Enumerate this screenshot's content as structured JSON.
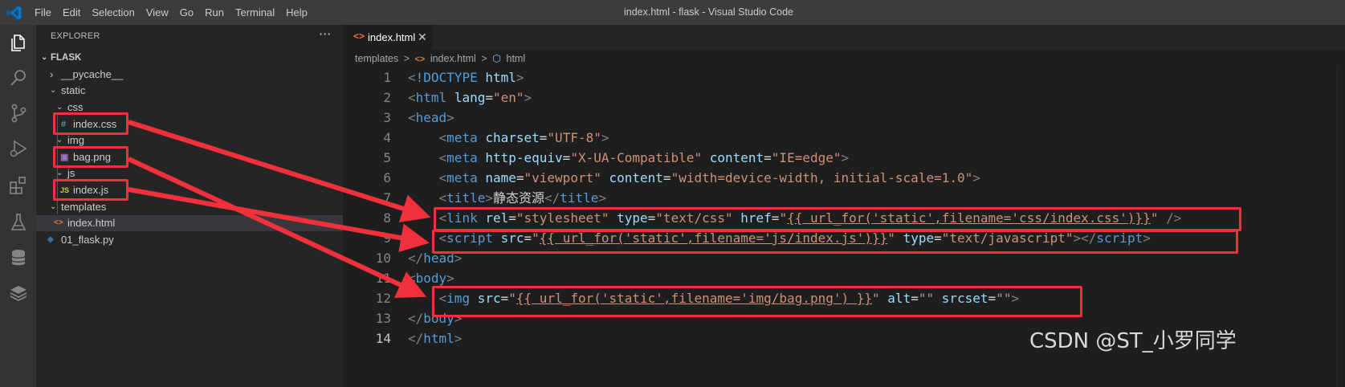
{
  "window": {
    "title": "index.html - flask - Visual Studio Code",
    "menu": [
      "File",
      "Edit",
      "Selection",
      "View",
      "Go",
      "Run",
      "Terminal",
      "Help"
    ]
  },
  "activity_bar": [
    "explorer-icon",
    "search-icon",
    "source-control-icon",
    "run-debug-icon",
    "extensions-icon",
    "testing-icon",
    "database-icon",
    "layers-icon"
  ],
  "explorer": {
    "header": "EXPLORER",
    "more": "···",
    "tree": [
      {
        "label": "FLASK",
        "kind": "root",
        "twisty": "⌄"
      },
      {
        "label": "__pycache__",
        "kind": "folder",
        "twisty": "›"
      },
      {
        "label": "static",
        "kind": "folder",
        "twisty": "⌄"
      },
      {
        "label": "css",
        "kind": "folder",
        "twisty": "⌄"
      },
      {
        "label": "index.css",
        "kind": "file",
        "icon": "#"
      },
      {
        "label": "img",
        "kind": "folder",
        "twisty": "⌄"
      },
      {
        "label": "bag.png",
        "kind": "file",
        "icon": "▣"
      },
      {
        "label": "js",
        "kind": "folder",
        "twisty": "⌄"
      },
      {
        "label": "index.js",
        "kind": "file",
        "icon": "JS"
      },
      {
        "label": "templates",
        "kind": "folder",
        "twisty": "⌄"
      },
      {
        "label": "index.html",
        "kind": "file",
        "icon": "<>"
      },
      {
        "label": "01_flask.py",
        "kind": "file",
        "icon": "◆"
      }
    ]
  },
  "tab": {
    "icon": "<>",
    "label": "index.html",
    "close": "✕"
  },
  "breadcrumb": {
    "folder": "templates",
    "sep": ">",
    "file_icon": "<>",
    "file": "index.html",
    "symbol_icon": "⬡",
    "symbol": "html"
  },
  "editor": {
    "line_numbers": [
      "1",
      "2",
      "3",
      "4",
      "5",
      "6",
      "7",
      "8",
      "9",
      "10",
      "11",
      "12",
      "13",
      "14"
    ],
    "current_line": 14,
    "lines": [
      [
        [
          "p",
          "<"
        ],
        [
          "t",
          "!DOCTYPE"
        ],
        [
          "x",
          " "
        ],
        [
          "a",
          "html"
        ],
        [
          "p",
          ">"
        ]
      ],
      [
        [
          "p",
          "<"
        ],
        [
          "t",
          "html"
        ],
        [
          "x",
          " "
        ],
        [
          "a",
          "lang"
        ],
        [
          "x",
          "="
        ],
        [
          "s",
          "\"en\""
        ],
        [
          "p",
          ">"
        ]
      ],
      [
        [
          "p",
          "<"
        ],
        [
          "t",
          "head"
        ],
        [
          "p",
          ">"
        ]
      ],
      [
        [
          "x",
          "    "
        ],
        [
          "p",
          "<"
        ],
        [
          "t",
          "meta"
        ],
        [
          "x",
          " "
        ],
        [
          "a",
          "charset"
        ],
        [
          "x",
          "="
        ],
        [
          "s",
          "\"UTF-8\""
        ],
        [
          "p",
          ">"
        ]
      ],
      [
        [
          "x",
          "    "
        ],
        [
          "p",
          "<"
        ],
        [
          "t",
          "meta"
        ],
        [
          "x",
          " "
        ],
        [
          "a",
          "http-equiv"
        ],
        [
          "x",
          "="
        ],
        [
          "s",
          "\"X-UA-Compatible\""
        ],
        [
          "x",
          " "
        ],
        [
          "a",
          "content"
        ],
        [
          "x",
          "="
        ],
        [
          "s",
          "\"IE=edge\""
        ],
        [
          "p",
          ">"
        ]
      ],
      [
        [
          "x",
          "    "
        ],
        [
          "p",
          "<"
        ],
        [
          "t",
          "meta"
        ],
        [
          "x",
          " "
        ],
        [
          "a",
          "name"
        ],
        [
          "x",
          "="
        ],
        [
          "s",
          "\"viewport\""
        ],
        [
          "x",
          " "
        ],
        [
          "a",
          "content"
        ],
        [
          "x",
          "="
        ],
        [
          "s",
          "\"width=device-width, initial-scale=1.0\""
        ],
        [
          "p",
          ">"
        ]
      ],
      [
        [
          "x",
          "    "
        ],
        [
          "p",
          "<"
        ],
        [
          "t",
          "title"
        ],
        [
          "p",
          ">"
        ],
        [
          "x",
          "静态资源"
        ],
        [
          "p",
          "</"
        ],
        [
          "t",
          "title"
        ],
        [
          "p",
          ">"
        ]
      ],
      [
        [
          "x",
          "    "
        ],
        [
          "p",
          "<"
        ],
        [
          "t",
          "link"
        ],
        [
          "x",
          " "
        ],
        [
          "a",
          "rel"
        ],
        [
          "x",
          "="
        ],
        [
          "s",
          "\"stylesheet\""
        ],
        [
          "x",
          " "
        ],
        [
          "a",
          "type"
        ],
        [
          "x",
          "="
        ],
        [
          "s",
          "\"text/css\""
        ],
        [
          "x",
          " "
        ],
        [
          "a",
          "href"
        ],
        [
          "x",
          "="
        ],
        [
          "s",
          "\""
        ],
        [
          "u",
          "{{ url_for('static',filename='css/index.css')}}"
        ],
        [
          "s",
          "\""
        ],
        [
          "x",
          " "
        ],
        [
          "p",
          "/>"
        ]
      ],
      [
        [
          "x",
          "    "
        ],
        [
          "p",
          "<"
        ],
        [
          "t",
          "script"
        ],
        [
          "x",
          " "
        ],
        [
          "a",
          "src"
        ],
        [
          "x",
          "="
        ],
        [
          "s",
          "\""
        ],
        [
          "u",
          "{{ url_for('static',filename='js/index.js')}}"
        ],
        [
          "s",
          "\""
        ],
        [
          "x",
          " "
        ],
        [
          "a",
          "type"
        ],
        [
          "x",
          "="
        ],
        [
          "s",
          "\"text/javascript\""
        ],
        [
          "p",
          ">"
        ],
        [
          "p",
          "</"
        ],
        [
          "t",
          "script"
        ],
        [
          "p",
          ">"
        ]
      ],
      [
        [
          "p",
          "</"
        ],
        [
          "t",
          "head"
        ],
        [
          "p",
          ">"
        ]
      ],
      [
        [
          "p",
          "<"
        ],
        [
          "t",
          "body"
        ],
        [
          "p",
          ">"
        ]
      ],
      [
        [
          "x",
          "    "
        ],
        [
          "p",
          "<"
        ],
        [
          "t",
          "img"
        ],
        [
          "x",
          " "
        ],
        [
          "a",
          "src"
        ],
        [
          "x",
          "="
        ],
        [
          "s",
          "\""
        ],
        [
          "u",
          "{{ url_for('static',filename='img/bag.png') }}"
        ],
        [
          "s",
          "\""
        ],
        [
          "x",
          " "
        ],
        [
          "a",
          "alt"
        ],
        [
          "x",
          "="
        ],
        [
          "s",
          "\"\""
        ],
        [
          "x",
          " "
        ],
        [
          "a",
          "srcset"
        ],
        [
          "x",
          "="
        ],
        [
          "s",
          "\"\""
        ],
        [
          "p",
          ">"
        ]
      ],
      [
        [
          "p",
          "</"
        ],
        [
          "t",
          "body"
        ],
        [
          "p",
          ">"
        ]
      ],
      [
        [
          "p",
          "</"
        ],
        [
          "t",
          "html"
        ],
        [
          "p",
          ">"
        ]
      ]
    ]
  },
  "annotation_color": "#f0313c",
  "watermark": "CSDN @ST_小罗同学"
}
